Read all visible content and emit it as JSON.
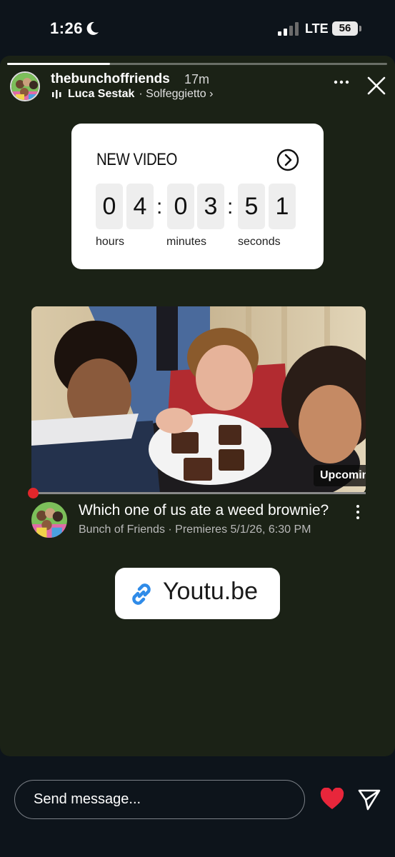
{
  "status": {
    "time": "1:26",
    "network": "LTE",
    "battery": "56"
  },
  "story": {
    "progress_fraction": 0.27,
    "username": "thebunchoffriends",
    "time_ago": "17m",
    "music": {
      "artist": "Luca Sestak",
      "song": "· Solfeggietto ›"
    }
  },
  "countdown": {
    "title": "NEW VIDEO",
    "hours": [
      "0",
      "4"
    ],
    "minutes": [
      "0",
      "3"
    ],
    "seconds": [
      "5",
      "1"
    ],
    "colon": ":",
    "labels": {
      "hours": "hours",
      "minutes": "minutes",
      "seconds": "seconds"
    }
  },
  "video": {
    "badge": "Upcoming",
    "title": "Which one of us ate a weed brownie?",
    "meta": "Bunch of Friends · Premieres 5/1/26, 6:30 PM"
  },
  "link": {
    "text": "Youtu.be"
  },
  "reply": {
    "placeholder": "Send message..."
  },
  "colors": {
    "story_bg": "#1b2216",
    "heart": "#e8263b",
    "link_icon": "#2f8be8",
    "video_dot": "#e0262b"
  }
}
